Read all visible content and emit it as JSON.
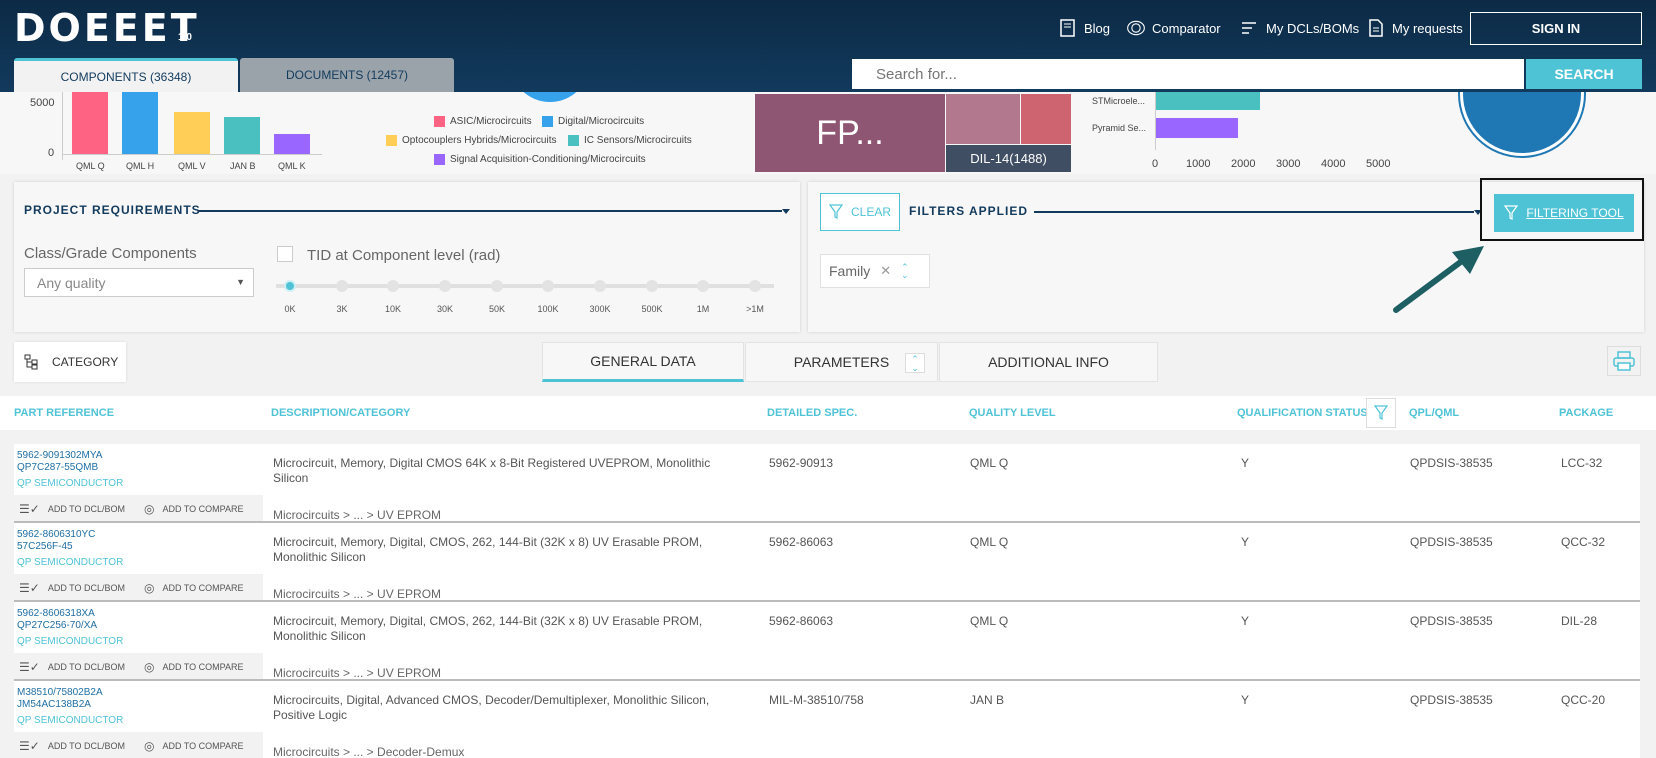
{
  "header": {
    "logo": "DOEEET",
    "version": "1.0",
    "nav": [
      "Blog",
      "Comparator",
      "My DCLs/BOMs",
      "My requests"
    ],
    "signin": "SIGN IN",
    "tabs": [
      "COMPONENTS (36348)",
      "DOCUMENTS (12457)"
    ],
    "search_placeholder": "Search for...",
    "search_button": "SEARCH"
  },
  "charts": {
    "bar_ytick_5000": "5000",
    "bar_ytick_0": "0",
    "bar_categories": [
      "QML Q",
      "QML H",
      "QML V",
      "JAN B",
      "QML K"
    ],
    "bar_colors": [
      "#ff6384",
      "#36a2eb",
      "#ffce56",
      "#4bc0c0",
      "#9966ff"
    ],
    "legend": [
      {
        "label": "ASIC/Microcircuits",
        "color": "#ff6384"
      },
      {
        "label": "Digital/Microcircuits",
        "color": "#36a2eb"
      },
      {
        "label": "Optocouplers Hybrids/Microcircuits",
        "color": "#ffce56"
      },
      {
        "label": "IC Sensors/Microcircuits",
        "color": "#4bc0c0"
      },
      {
        "label": "Signal Acquisition-Conditioning/Microcircuits",
        "color": "#9966ff"
      }
    ],
    "treemap_fp": "FP...",
    "treemap_dil": "DIL-14(1488)",
    "hbar_labels": [
      "STMicroele...",
      "Pyramid Se..."
    ],
    "hbar_ticks": [
      "0",
      "1000",
      "2000",
      "3000",
      "4000",
      "5000"
    ]
  },
  "project": {
    "title": "PROJECT REQUIREMENTS",
    "class_label": "Class/Grade Components",
    "quality_value": "Any quality",
    "tid_label": "TID at Component level (rad)",
    "tid_steps": [
      "0K",
      "3K",
      "10K",
      "30K",
      "50K",
      "100K",
      "300K",
      "500K",
      "1M",
      ">1M"
    ]
  },
  "filters": {
    "clear": "CLEAR",
    "title": "FILTERS APPLIED",
    "tool": "FILTERING TOOL",
    "chip": "Family"
  },
  "tabs_row": {
    "category": "CATEGORY",
    "general": "GENERAL DATA",
    "parameters": "PARAMETERS",
    "additional": "ADDITIONAL INFO"
  },
  "table": {
    "headers": [
      "PART REFERENCE",
      "DESCRIPTION/CATEGORY",
      "DETAILED SPEC.",
      "QUALITY LEVEL",
      "QUALIFICATION STATUS",
      "QPL/QML",
      "PACKAGE"
    ],
    "add_dcl": "ADD TO DCL/BOM",
    "add_compare": "ADD TO COMPARE",
    "rows": [
      {
        "part1": "5962-9091302MYA",
        "part2": "QP7C287-55QMB",
        "manufacturer": "QP SEMICONDUCTOR",
        "description": "Microcircuit, Memory, Digital CMOS 64K x 8-Bit Registered UVEPROM, Monolithic Silicon",
        "category": "Microcircuits >  ...  >  UV EPROM",
        "spec": "5962-90913",
        "quality": "QML Q",
        "status": "Y",
        "qpl": "QPDSIS-38535",
        "package": "LCC-32"
      },
      {
        "part1": "5962-8606310YC",
        "part2": "57C256F-45",
        "manufacturer": "QP SEMICONDUCTOR",
        "description": "Microcircuit, Memory, Digital, CMOS, 262, 144-Bit (32K x 8) UV Erasable PROM, Monolithic Silicon",
        "category": "Microcircuits >  ...  >  UV EPROM",
        "spec": "5962-86063",
        "quality": "QML Q",
        "status": "Y",
        "qpl": "QPDSIS-38535",
        "package": "QCC-32"
      },
      {
        "part1": "5962-8606318XA",
        "part2": "QP27C256-70/XA",
        "manufacturer": "QP SEMICONDUCTOR",
        "description": "Microcircuit, Memory, Digital, CMOS, 262, 144-Bit (32K x 8) UV Erasable PROM, Monolithic Silicon",
        "category": "Microcircuits >  ...  >  UV EPROM",
        "spec": "5962-86063",
        "quality": "QML Q",
        "status": "Y",
        "qpl": "QPDSIS-38535",
        "package": "DIL-28"
      },
      {
        "part1": "M38510/75802B2A",
        "part2": "JM54AC138B2A",
        "manufacturer": "QP SEMICONDUCTOR",
        "description": "Microcircuits, Digital, Advanced CMOS, Decoder/Demultiplexer, Monolithic Silicon, Positive Logic",
        "category": "Microcircuits >  ...  >  Decoder-Demux",
        "spec": "MIL-M-38510/758",
        "quality": "JAN B",
        "status": "Y",
        "qpl": "QPDSIS-38535",
        "package": "QCC-20"
      }
    ]
  },
  "colors": {
    "accent": "#4fc3d6",
    "navy": "#123a5d",
    "link": "#1f6ea3"
  }
}
